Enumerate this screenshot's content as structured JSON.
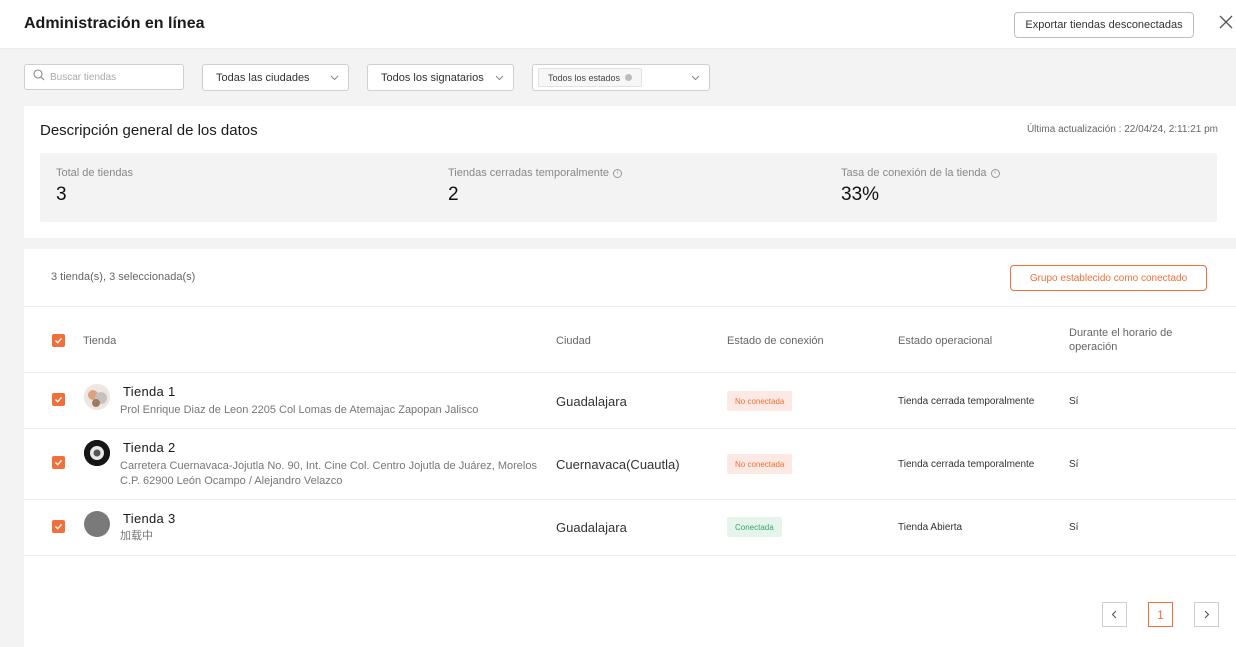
{
  "header": {
    "title": "Administración en línea",
    "export_label": "Exportar tiendas desconectadas"
  },
  "filters": {
    "search_placeholder": "Buscar tiendas",
    "city_label": "Todas las ciudades",
    "signatory_label": "Todos los signatarios",
    "state_chip": "Todos los estados"
  },
  "overview": {
    "title": "Descripción general de los datos",
    "updated": "Última actualización : 22/04/24, 2:11:21 pm",
    "stats": [
      {
        "label": "Total de tiendas",
        "value": "3"
      },
      {
        "label": "Tiendas cerradas temporalmente",
        "value": "2"
      },
      {
        "label": "Tasa de conexión de la tienda",
        "value": "33%"
      }
    ]
  },
  "list": {
    "selection": "3 tienda(s), 3 seleccionada(s)",
    "group_button": "Grupo establecido como conectado",
    "columns": {
      "store": "Tienda",
      "city": "Ciudad",
      "connection": "Estado de conexión",
      "operational": "Estado operacional",
      "hours_line1": "Durante el horario de",
      "hours_line2": "operación"
    },
    "rows": [
      {
        "name": "Tienda  1",
        "address": "Prol Enrique Diaz de Leon 2205 Col Lomas de Atemajac Zapopan Jalisco",
        "city": "Guadalajara",
        "connection": "No conectada",
        "operational": "Tienda cerrada temporalmente",
        "hours": "Sí"
      },
      {
        "name": "Tienda  2",
        "address": "Carretera Cuernavaca-Jojutla No. 90, Int. Cine Col. Centro Jojutla de Juárez, Morelos C.P. 62900 León Ocampo / Alejandro Velazco",
        "city": "Cuernavaca(Cuautla)",
        "connection": "No conectada",
        "operational": "Tienda cerrada temporalmente",
        "hours": "Sí"
      },
      {
        "name": "Tienda  3",
        "address": "加载中",
        "city": "Guadalajara",
        "connection": "Conectada",
        "operational": "Tienda Abierta",
        "hours": "Sí"
      }
    ]
  },
  "pagination": {
    "current": "1"
  },
  "colors": {
    "accent": "#f0703a",
    "connected": "#3aa76d"
  }
}
